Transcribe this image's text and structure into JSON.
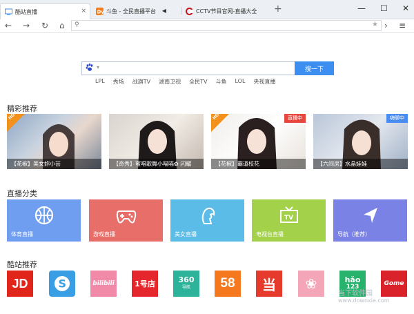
{
  "tabs": [
    {
      "title": "酷站直播",
      "active": true,
      "close": "×"
    },
    {
      "title": "斗鱼 - 全民直播平台",
      "active": false,
      "audio": "◀"
    },
    {
      "title": "CCTV节目官网-直播大全",
      "active": false
    }
  ],
  "new_tab": "+",
  "window_controls": {
    "minimize": "—",
    "maximize": "☐",
    "close": "✕"
  },
  "nav": {
    "back": "←",
    "forward": "→",
    "reload": "↻",
    "home": "⌂",
    "address_value": "",
    "star": "★",
    "side": "›",
    "menu": "≡"
  },
  "search": {
    "value": "",
    "button": "搜一下",
    "hotwords": [
      "LPL",
      "秀场",
      "战旗TV",
      "湖南卫视",
      "全民TV",
      "斗鱼",
      "LOL",
      "央视直播"
    ]
  },
  "sections": {
    "recommend": "精彩推荐",
    "category": "直播分类",
    "sites": "酷站推荐"
  },
  "recommend": [
    {
      "label": "【花椒】美女妳小芸",
      "badge": "HOT",
      "badge_type": "hot"
    },
    {
      "label": "【奇秀】蜜唱歌舞小喵喵✿ 闪耀",
      "badge": "",
      "badge_type": ""
    },
    {
      "label": "【花椒】霸道校花",
      "badge": "直播中",
      "badge_type": "hot-live"
    },
    {
      "label": "【六间房】水晶娃娃",
      "badge": "嗨聊中",
      "badge_type": "chat"
    }
  ],
  "categories": [
    {
      "label": "体育直播",
      "icon": "basketball-icon",
      "color": "#6f9ef0"
    },
    {
      "label": "游戏直播",
      "icon": "gamepad-icon",
      "color": "#e86e6a"
    },
    {
      "label": "美女直播",
      "icon": "face-silhouette-icon",
      "color": "#5cbce8"
    },
    {
      "label": "电视台直播",
      "icon": "tv-icon",
      "color": "#a3d24a"
    },
    {
      "label": "导航（推荐）",
      "icon": "navigation-arrow-icon",
      "color": "#7b82e6"
    }
  ],
  "sites": [
    {
      "name": "JD",
      "icon": "jd-logo-icon",
      "color": "#e1251b"
    },
    {
      "name": "S",
      "icon": "sogou-logo-icon",
      "color": "#3a9ee4"
    },
    {
      "name": "bilibili",
      "icon": "bilibili-logo-icon",
      "color": "#f08aa8"
    },
    {
      "name": "1号店",
      "icon": "yhd-logo-icon",
      "color": "#e5272d"
    },
    {
      "name": "360",
      "sub": "导航",
      "icon": "360-nav-logo-icon",
      "color": "#2cb39a"
    },
    {
      "name": "58",
      "icon": "58-logo-icon",
      "color": "#f6781e"
    },
    {
      "name": "当",
      "icon": "dangdang-logo-icon",
      "color": "#e63a2c"
    },
    {
      "name": "❀",
      "icon": "meilishuo-logo-icon",
      "color": "#f5a5b8"
    },
    {
      "name": "hǎo",
      "sub": "123",
      "icon": "hao123-logo-icon",
      "color": "#28b36d"
    },
    {
      "name": "Gome",
      "icon": "gome-logo-icon",
      "color": "#d9222a"
    }
  ],
  "watermark": {
    "line1": "当下软件园",
    "line2": "www.downxia.com"
  }
}
